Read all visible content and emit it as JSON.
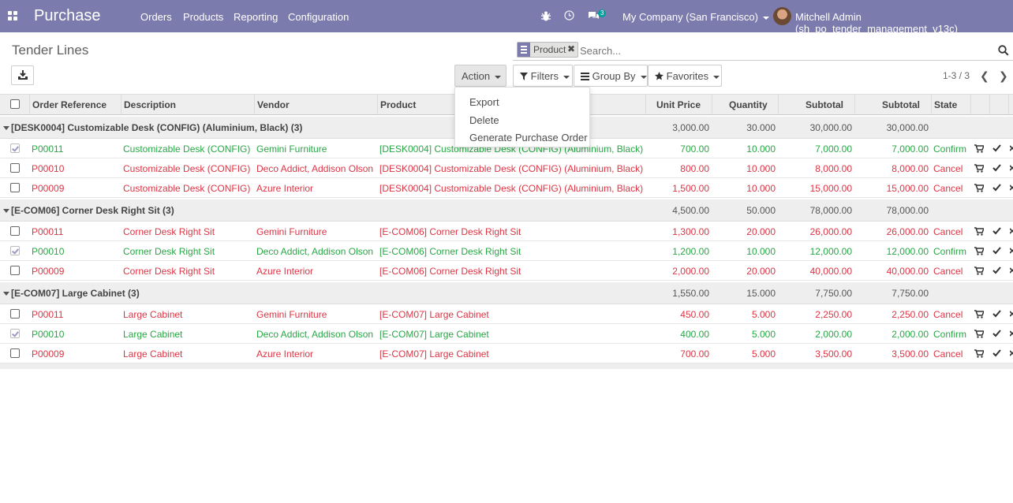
{
  "navbar": {
    "app_name": "Purchase",
    "menu": [
      "Orders",
      "Products",
      "Reporting",
      "Configuration"
    ],
    "message_count": "3",
    "company": "My Company (San Francisco)",
    "user": "Mitchell Admin (sh_po_tender_management_v13c)",
    "bg_color": "#7c7bad"
  },
  "control": {
    "title": "Tender Lines",
    "facet": "Product",
    "search_placeholder": "Search...",
    "action": "Action",
    "filters": "Filters",
    "group_by": "Group By",
    "favorites": "Favorites",
    "pager": "1-3 / 3"
  },
  "action_menu": [
    "Export",
    "Delete",
    "Generate Purchase Order"
  ],
  "table": {
    "headers": [
      "Order Reference",
      "Description",
      "Vendor",
      "Product",
      "Unit Price",
      "Quantity",
      "Subtotal",
      "Subtotal",
      "State"
    ],
    "groups": [
      {
        "label": "[DESK0004] Customizable Desk (CONFIG) (Aluminium, Black) (3)",
        "unit_price": "3,000.00",
        "quantity": "30.000",
        "subtotal": "30,000.00",
        "subtotal2": "30,000.00",
        "rows": [
          {
            "checked": true,
            "color": "green",
            "ref": "P00011",
            "desc": "Customizable Desk (CONFIG)",
            "vendor": "Gemini Furniture",
            "product": "[DESK0004] Customizable Desk (CONFIG) (Aluminium, Black)",
            "price": "700.00",
            "qty": "10.000",
            "sub": "7,000.00",
            "sub2": "7,000.00",
            "state": "Confirm"
          },
          {
            "checked": false,
            "color": "red",
            "ref": "P00010",
            "desc": "Customizable Desk (CONFIG)",
            "vendor": "Deco Addict, Addison Olson",
            "product": "[DESK0004] Customizable Desk (CONFIG) (Aluminium, Black)",
            "price": "800.00",
            "qty": "10.000",
            "sub": "8,000.00",
            "sub2": "8,000.00",
            "state": "Cancel"
          },
          {
            "checked": false,
            "color": "red",
            "ref": "P00009",
            "desc": "Customizable Desk (CONFIG)",
            "vendor": "Azure Interior",
            "product": "[DESK0004] Customizable Desk (CONFIG) (Aluminium, Black)",
            "price": "1,500.00",
            "qty": "10.000",
            "sub": "15,000.00",
            "sub2": "15,000.00",
            "state": "Cancel"
          }
        ]
      },
      {
        "label": "[E-COM06] Corner Desk Right Sit (3)",
        "unit_price": "4,500.00",
        "quantity": "50.000",
        "subtotal": "78,000.00",
        "subtotal2": "78,000.00",
        "rows": [
          {
            "checked": false,
            "color": "red",
            "ref": "P00011",
            "desc": "Corner Desk Right Sit",
            "vendor": "Gemini Furniture",
            "product": "[E-COM06] Corner Desk Right Sit",
            "price": "1,300.00",
            "qty": "20.000",
            "sub": "26,000.00",
            "sub2": "26,000.00",
            "state": "Cancel"
          },
          {
            "checked": true,
            "color": "green",
            "ref": "P00010",
            "desc": "Corner Desk Right Sit",
            "vendor": "Deco Addict, Addison Olson",
            "product": "[E-COM06] Corner Desk Right Sit",
            "price": "1,200.00",
            "qty": "10.000",
            "sub": "12,000.00",
            "sub2": "12,000.00",
            "state": "Confirm"
          },
          {
            "checked": false,
            "color": "red",
            "ref": "P00009",
            "desc": "Corner Desk Right Sit",
            "vendor": "Azure Interior",
            "product": "[E-COM06] Corner Desk Right Sit",
            "price": "2,000.00",
            "qty": "20.000",
            "sub": "40,000.00",
            "sub2": "40,000.00",
            "state": "Cancel"
          }
        ]
      },
      {
        "label": "[E-COM07] Large Cabinet (3)",
        "unit_price": "1,550.00",
        "quantity": "15.000",
        "subtotal": "7,750.00",
        "subtotal2": "7,750.00",
        "rows": [
          {
            "checked": false,
            "color": "red",
            "ref": "P00011",
            "desc": "Large Cabinet",
            "vendor": "Gemini Furniture",
            "product": "[E-COM07] Large Cabinet",
            "price": "450.00",
            "qty": "5.000",
            "sub": "2,250.00",
            "sub2": "2,250.00",
            "state": "Cancel"
          },
          {
            "checked": true,
            "color": "green",
            "ref": "P00010",
            "desc": "Large Cabinet",
            "vendor": "Deco Addict, Addison Olson",
            "product": "[E-COM07] Large Cabinet",
            "price": "400.00",
            "qty": "5.000",
            "sub": "2,000.00",
            "sub2": "2,000.00",
            "state": "Confirm"
          },
          {
            "checked": false,
            "color": "red",
            "ref": "P00009",
            "desc": "Large Cabinet",
            "vendor": "Azure Interior",
            "product": "[E-COM07] Large Cabinet",
            "price": "700.00",
            "qty": "5.000",
            "sub": "3,500.00",
            "sub2": "3,500.00",
            "state": "Cancel"
          }
        ]
      }
    ]
  }
}
